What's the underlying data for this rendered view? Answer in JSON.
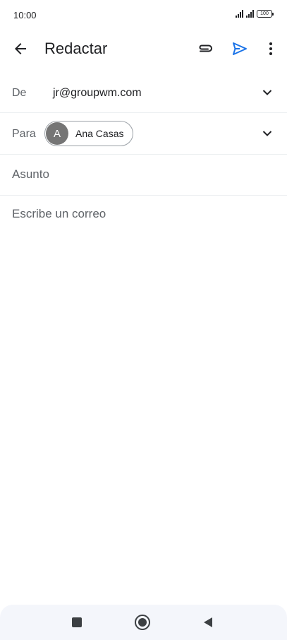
{
  "status_bar": {
    "time": "10:00",
    "battery": "100"
  },
  "toolbar": {
    "title": "Redactar",
    "back_icon": "arrow-left-icon",
    "attach_icon": "paperclip-icon",
    "send_icon": "send-icon",
    "more_icon": "more-vert-icon",
    "accent_color": "#1a73e8"
  },
  "from": {
    "label": "De",
    "value": "jr@groupwm.com"
  },
  "to": {
    "label": "Para",
    "recipients": [
      {
        "initial": "A",
        "name": "Ana Casas"
      }
    ]
  },
  "subject": {
    "placeholder": "Asunto"
  },
  "body": {
    "placeholder": "Escribe un correo"
  },
  "nav": {
    "recents_icon": "square-icon",
    "home_icon": "circle-home-icon",
    "back_icon": "triangle-back-icon"
  }
}
